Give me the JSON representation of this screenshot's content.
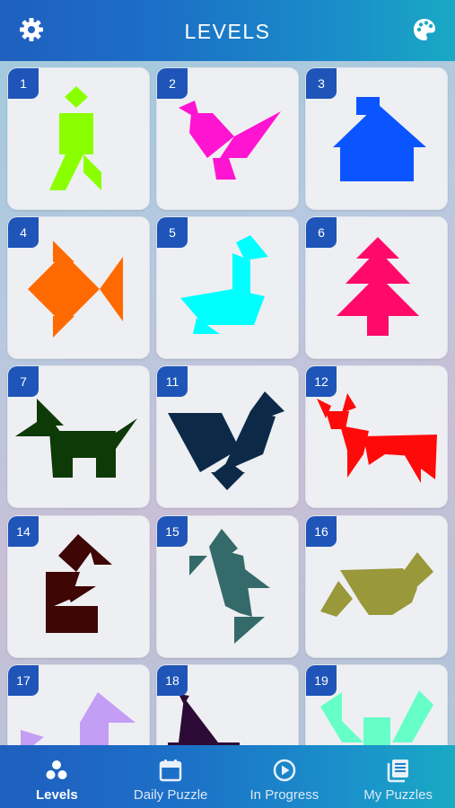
{
  "header": {
    "title": "LEVELS",
    "settings_icon": "gear-icon",
    "theme_icon": "palette-icon"
  },
  "levels": [
    {
      "number": "1",
      "color": "#8aff00",
      "shape": "person"
    },
    {
      "number": "2",
      "color": "#ff14d2",
      "shape": "bird"
    },
    {
      "number": "3",
      "color": "#0a55ff",
      "shape": "house"
    },
    {
      "number": "4",
      "color": "#ff6a00",
      "shape": "fish"
    },
    {
      "number": "5",
      "color": "#00ffff",
      "shape": "swan"
    },
    {
      "number": "6",
      "color": "#ff0a6a",
      "shape": "tree"
    },
    {
      "number": "7",
      "color": "#0d3a06",
      "shape": "dog"
    },
    {
      "number": "11",
      "color": "#0c2a48",
      "shape": "rooster"
    },
    {
      "number": "12",
      "color": "#ff0a0a",
      "shape": "deer"
    },
    {
      "number": "14",
      "color": "#3f0606",
      "shape": "figure"
    },
    {
      "number": "15",
      "color": "#346a6a",
      "shape": "fish-vertical"
    },
    {
      "number": "16",
      "color": "#99983a",
      "shape": "fox"
    },
    {
      "number": "17",
      "color": "#c49ef5",
      "shape": "partial-a"
    },
    {
      "number": "18",
      "color": "#2c0c36",
      "shape": "partial-b"
    },
    {
      "number": "19",
      "color": "#66ffc8",
      "shape": "partial-c"
    }
  ],
  "tabs": [
    {
      "label": "Levels",
      "icon": "three-dots-icon",
      "active": true
    },
    {
      "label": "Daily Puzzle",
      "icon": "calendar-icon",
      "active": false
    },
    {
      "label": "In Progress",
      "icon": "play-circle-icon",
      "active": false
    },
    {
      "label": "My Puzzles",
      "icon": "stacked-pages-icon",
      "active": false
    }
  ]
}
